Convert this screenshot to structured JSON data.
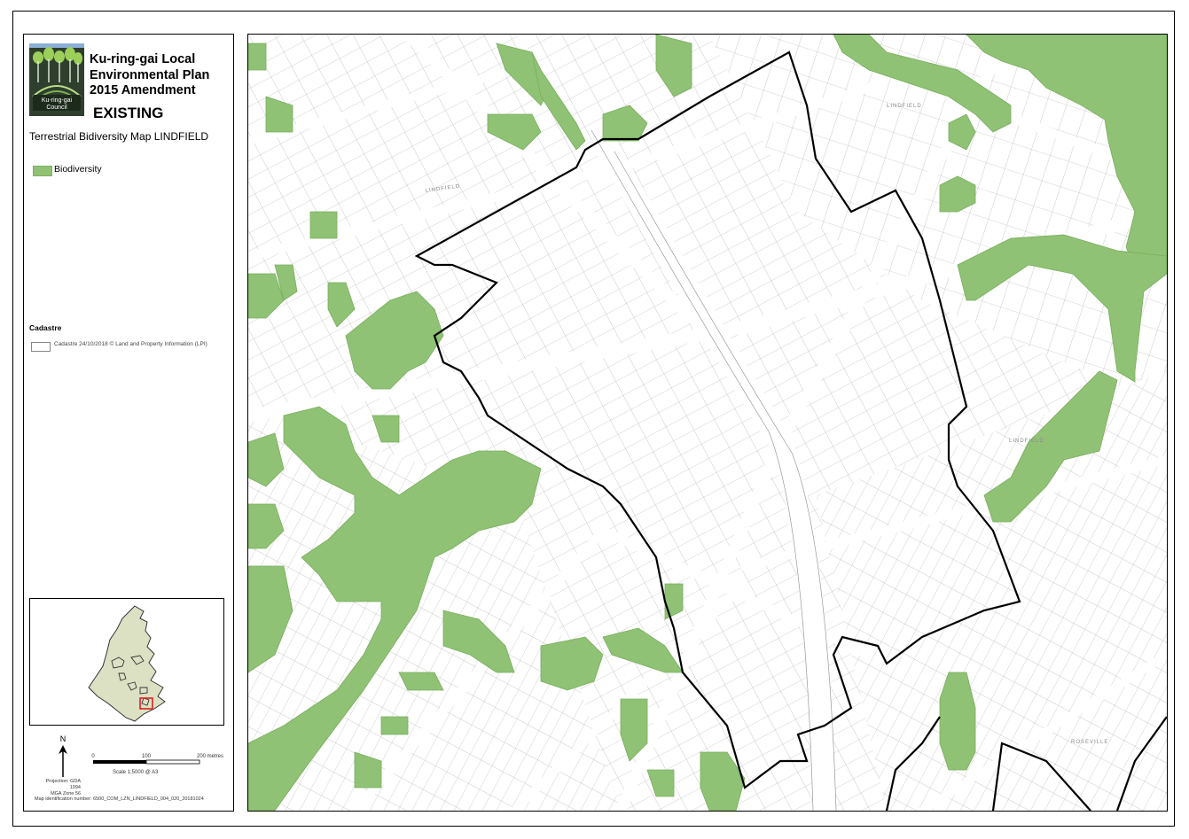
{
  "title": {
    "line1": "Ku-ring-gai Local",
    "line2": "Environmental Plan",
    "line3": "2015 Amendment",
    "status": "EXISTING",
    "map_name": "Terrestrial Bidiversity Map LINDFIELD"
  },
  "logo": {
    "council_name": "Ku-ring-gai Council"
  },
  "legend": {
    "biodiversity_label": "Biodiversity",
    "cadastre_heading": "Cadastre",
    "cadastre_label": "Cadastre 24/10/2018 © Land and Property Information (LPI)"
  },
  "colors": {
    "biodiversity": "#8fc274",
    "boundary": "#000000",
    "cadastre": "#9a9a9a",
    "inset_lga": "#dde1c4",
    "inset_marker": "#e02020"
  },
  "footer": {
    "north_label": "N",
    "scale_ticks": [
      "0",
      "100",
      "200 metres"
    ],
    "scale_text": "Scale   1:5000    @ A3",
    "projection_line1": "Projection: GDA 1994",
    "projection_line2": "MGA Zone 56",
    "map_id": "Map identification number:   6500_COM_LZN_LINDFIELD_004_020_20181024"
  },
  "street_labels": [
    "LINDFIELD",
    "LINDFIELD",
    "LINDFIELD",
    "ROSEVILLE"
  ]
}
